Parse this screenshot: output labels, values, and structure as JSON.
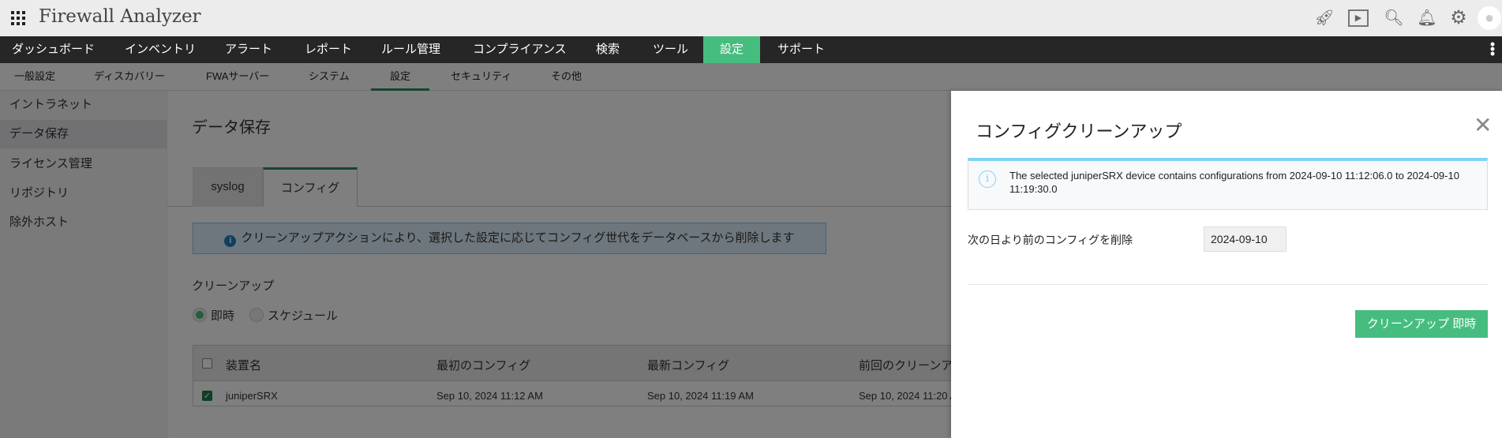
{
  "header": {
    "title": "Firewall Analyzer",
    "icons": [
      "rocket-icon",
      "presentation-icon",
      "search-icon",
      "bell-icon",
      "gear-icon",
      "user-avatar-icon"
    ]
  },
  "nav": {
    "items": [
      "ダッシュボード",
      "インベントリ",
      "アラート",
      "レポート",
      "ルール管理",
      "コンプライアンス",
      "検索",
      "ツール",
      "設定",
      "サポート"
    ],
    "active": "設定"
  },
  "subnav": {
    "items": [
      "一般設定",
      "ディスカバリー",
      "FWAサーバー",
      "システム",
      "設定",
      "セキュリティ",
      "その他"
    ],
    "active": "設定"
  },
  "sidebar": {
    "items": [
      "イントラネット",
      "データ保存",
      "ライセンス管理",
      "リポジトリ",
      "除外ホスト"
    ],
    "active": "データ保存"
  },
  "main": {
    "title": "データ保存",
    "tabs": [
      "syslog",
      "コンフィグ"
    ],
    "info": "クリーンアップアクションにより、選択した設定に応じてコンフィグ世代をデータベースから削除します",
    "cleanup_label": "クリーンアップ",
    "radio": [
      "即時",
      "スケジュール"
    ],
    "table": {
      "headers": [
        "装置名",
        "最初のコンフィグ",
        "最新コンフィグ",
        "前回のクリーンアッ"
      ],
      "rows": [
        [
          "juniperSRX",
          "Sep 10, 2024 11:12 AM",
          "Sep 10, 2024 11:19 AM",
          "Sep 10, 2024 11:20 A"
        ]
      ]
    }
  },
  "modal": {
    "title": "コンフィグクリーンアップ",
    "info": "The selected juniperSRX device contains configurations from 2024-09-10 11:12:06.0 to 2024-09-10 11:19:30.0",
    "delete_label": "次の日より前のコンフィグを削除",
    "date_value": "2024-09-10",
    "button": "クリーンアップ 即時"
  },
  "colors": {
    "accent": "#46bd7f",
    "nav_bg": "#262626",
    "info_border": "#7fd3f5"
  }
}
